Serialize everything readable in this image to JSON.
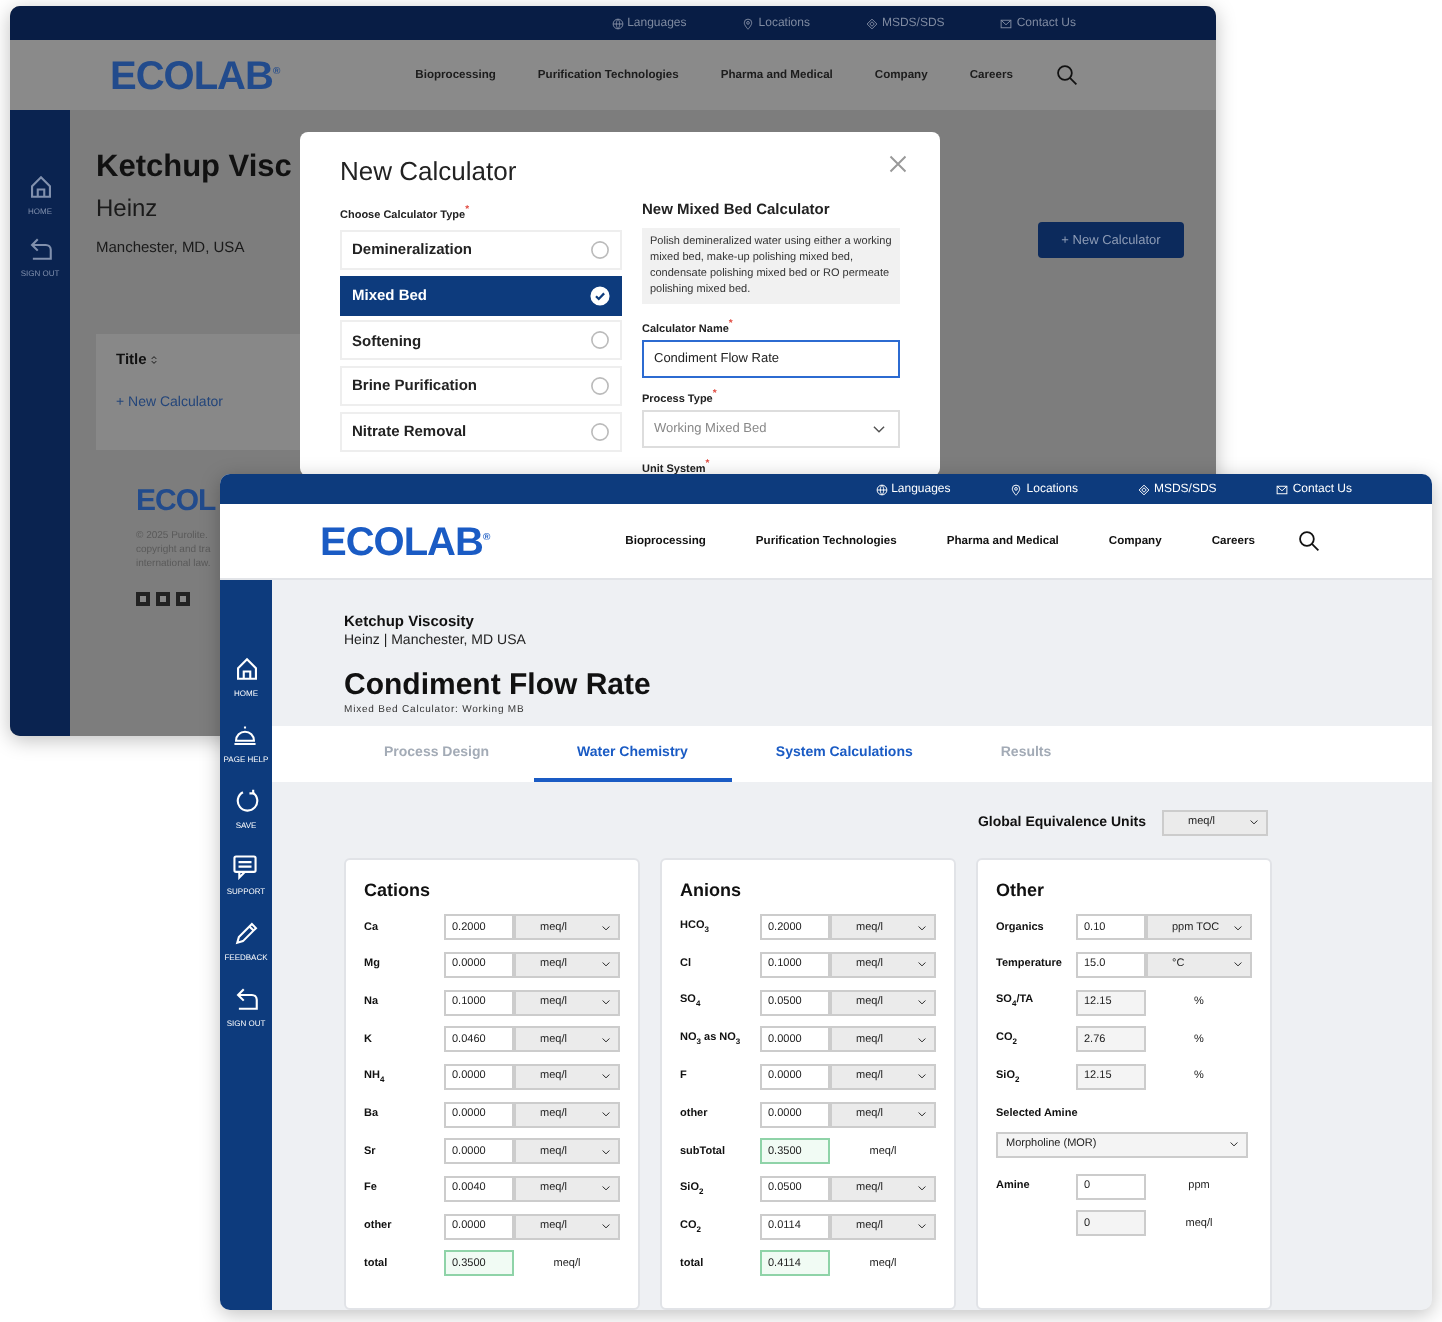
{
  "back_window": {
    "top_links": [
      "Languages",
      "Locations",
      "MSDS/SDS",
      "Contact Us"
    ],
    "logo": "ECOLAB$^{®}$",
    "nav": [
      "Bioprocessing",
      "Purification Technologies",
      "Pharma and Medical",
      "Company",
      "Careers"
    ],
    "sidebar": [
      "HOME",
      "SIGN OUT"
    ],
    "page": {
      "title": "Ketchup Visc",
      "client": "Heinz",
      "location": "Manchester, MD, USA",
      "new_button": "+ New Calculator",
      "column": "Title",
      "link": "+ New Calculator"
    },
    "footer": {
      "logo": "ECOL",
      "text": "© 2025 Purolite.\ncopyright and tra\ninternational law."
    },
    "modal": {
      "title": "New Calculator",
      "type_label": "Choose Calculator Type$^{*}$",
      "options": [
        {
          "label": "Demineralization",
          "selected": false
        },
        {
          "label": "Mixed Bed",
          "selected": true
        },
        {
          "label": "Softening",
          "selected": false
        },
        {
          "label": "Brine Purification",
          "selected": false
        },
        {
          "label": "Nitrate Removal",
          "selected": false
        }
      ],
      "heading": "New Mixed Bed Calculator",
      "description": "Polish demineralized water using either a working mixed bed, make-up polishing mixed bed, condensate polishing mixed bed or RO permeate polishing mixed bed.",
      "name_label": "Calculator Name$^{*}$",
      "name_value": "Condiment Flow Rate",
      "name_focused": true,
      "process_label": "Process Type$^{*}$",
      "process_value": "Working Mixed Bed",
      "unit_label": "Unit System$^{*}$"
    }
  },
  "front_window": {
    "top_links": [
      "Languages",
      "Locations",
      "MSDS/SDS",
      "Contact Us"
    ],
    "logo": "ECOLAB$^{®}$",
    "nav": [
      "Bioprocessing",
      "Purification Technologies",
      "Pharma and Medical",
      "Company",
      "Careers"
    ],
    "sidebar": [
      "HOME",
      "PAGE HELP",
      "SAVE",
      "SUPPORT",
      "FEEDBACK",
      "SIGN OUT"
    ],
    "header": {
      "project": "Ketchup Viscosity",
      "client_location": "Heinz | Manchester, MD USA",
      "title": "Condiment Flow Rate",
      "subtitle": "Mixed Bed Calculator: Working MB"
    },
    "tabs": [
      {
        "label": "Process Design",
        "selected": false,
        "disabled": true
      },
      {
        "label": "Water Chemistry",
        "selected": true,
        "disabled": false
      },
      {
        "label": "System Calculations",
        "selected": false,
        "disabled": false
      },
      {
        "label": "Results",
        "selected": false,
        "disabled": true
      }
    ],
    "global_units": {
      "label": "Global Equivalence Units",
      "value": "meq/l"
    },
    "cards": [
      {
        "title": "Cations",
        "rows": [
          {
            "kind": "select",
            "label": "Ca",
            "value": "0.2000",
            "unit": "meq/l"
          },
          {
            "kind": "select",
            "label": "Mg",
            "value": "0.0000",
            "unit": "meq/l"
          },
          {
            "kind": "select",
            "label": "Na",
            "value": "0.1000",
            "unit": "meq/l"
          },
          {
            "kind": "select",
            "label": "K",
            "value": "0.0460",
            "unit": "meq/l"
          },
          {
            "kind": "select",
            "label": "NH$_{4}$",
            "value": "0.0000",
            "unit": "meq/l"
          },
          {
            "kind": "select",
            "label": "Ba",
            "value": "0.0000",
            "unit": "meq/l"
          },
          {
            "kind": "select",
            "label": "Sr",
            "value": "0.0000",
            "unit": "meq/l"
          },
          {
            "kind": "select",
            "label": "Fe",
            "value": "0.0040",
            "unit": "meq/l"
          },
          {
            "kind": "select",
            "label": "other",
            "value": "0.0000",
            "unit": "meq/l"
          },
          {
            "kind": "total",
            "label": "total",
            "value": "0.3500",
            "unit": "meq/l"
          }
        ]
      },
      {
        "title": "Anions",
        "rows": [
          {
            "kind": "select",
            "label": "HCO$_{3}$",
            "value": "0.2000",
            "unit": "meq/l"
          },
          {
            "kind": "select",
            "label": "Cl",
            "value": "0.1000",
            "unit": "meq/l"
          },
          {
            "kind": "select",
            "label": "SO$_{4}$",
            "value": "0.0500",
            "unit": "meq/l"
          },
          {
            "kind": "select",
            "label": "NO$_{3}$ as NO$_{3}$",
            "value": "0.0000",
            "unit": "meq/l"
          },
          {
            "kind": "select",
            "label": "F",
            "value": "0.0000",
            "unit": "meq/l"
          },
          {
            "kind": "select",
            "label": "other",
            "value": "0.0000",
            "unit": "meq/l"
          },
          {
            "kind": "total",
            "label": "subTotal",
            "value": "0.3500",
            "unit": "meq/l"
          },
          {
            "kind": "select",
            "label": "SiO$_{2}$",
            "value": "0.0500",
            "unit": "meq/l"
          },
          {
            "kind": "select",
            "label": "CO$_{2}$",
            "value": "0.0114",
            "unit": "meq/l"
          },
          {
            "kind": "total",
            "label": "total",
            "value": "0.4114",
            "unit": "meq/l"
          }
        ]
      },
      {
        "title": "Other",
        "rows": [
          {
            "kind": "select",
            "label": "Organics",
            "value": "0.10",
            "unit": "ppm TOC"
          },
          {
            "kind": "select",
            "label": "Temperature",
            "value": "15.0",
            "unit": "°C"
          },
          {
            "kind": "readonly",
            "label": "SO$_{4}$/TA",
            "value": "12.15",
            "unit": "%"
          },
          {
            "kind": "readonly",
            "label": "CO$_{2}$",
            "value": "2.76",
            "unit": "%"
          },
          {
            "kind": "readonly",
            "label": "SiO$_{2}$",
            "value": "12.15",
            "unit": "%"
          },
          {
            "kind": "heading",
            "label": "Selected Amine"
          },
          {
            "kind": "dropdown",
            "value": "Morpholine (MOR)"
          },
          {
            "kind": "input",
            "label": "Amine",
            "value": "0",
            "unit": "ppm"
          },
          {
            "kind": "readonly",
            "value": "0",
            "unit": "meq/l"
          }
        ]
      }
    ]
  }
}
